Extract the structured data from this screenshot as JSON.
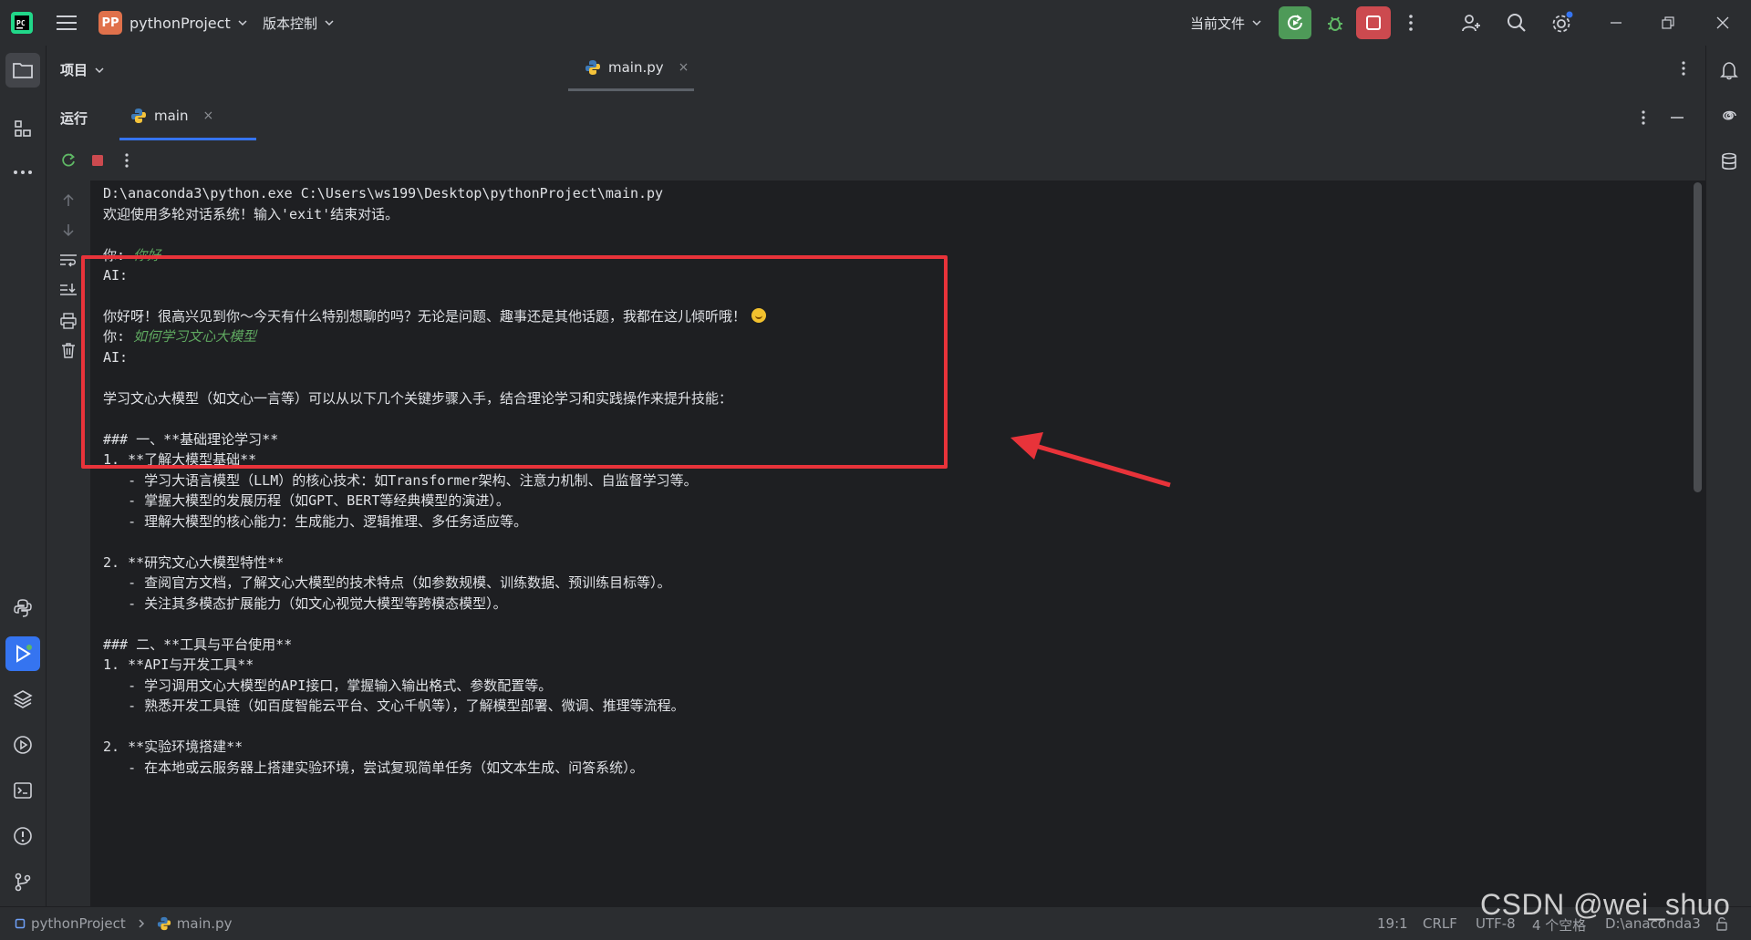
{
  "titlebar": {
    "project_badge": "PP",
    "project_name": "pythonProject",
    "vcs_label": "版本控制",
    "current_file_label": "当前文件"
  },
  "project_panel": {
    "title": "项目"
  },
  "editor": {
    "tabs": [
      {
        "label": "main.py",
        "close": "×"
      }
    ]
  },
  "run_panel": {
    "title": "运行",
    "tab_label": "main",
    "tab_close": "×"
  },
  "console": {
    "lines": [
      {
        "text": "D:\\anaconda3\\python.exe C:\\Users\\ws199\\Desktop\\pythonProject\\main.py"
      },
      {
        "text": "欢迎使用多轮对话系统！输入'exit'结束对话。"
      },
      {
        "prefix": "你: ",
        "input": "你好"
      },
      {
        "text": "AI:"
      },
      {
        "text": "你好呀！很高兴见到你～今天有什么特别想聊的吗？无论是问题、趣事还是其他话题，我都在这儿倾听哦！"
      },
      {
        "prefix": "你: ",
        "input": "如何学习文心大模型"
      },
      {
        "text": "AI:"
      },
      {
        "text": "学习文心大模型（如文心一言等）可以从以下几个关键步骤入手，结合理论学习和实践操作来提升技能："
      },
      {
        "text": "### 一、**基础理论学习**"
      },
      {
        "text": "1. **了解大模型基础**"
      },
      {
        "text": "   - 学习大语言模型（LLM）的核心技术：如Transformer架构、注意力机制、自监督学习等。"
      },
      {
        "text": "   - 掌握大模型的发展历程（如GPT、BERT等经典模型的演进）。"
      },
      {
        "text": "   - 理解大模型的核心能力：生成能力、逻辑推理、多任务适应等。"
      },
      {
        "text": "2. **研究文心大模型特性**"
      },
      {
        "text": "   - 查阅官方文档，了解文心大模型的技术特点（如参数规模、训练数据、预训练目标等）。"
      },
      {
        "text": "   - 关注其多模态扩展能力（如文心视觉大模型等跨模态模型）。"
      },
      {
        "text": "### 二、**工具与平台使用**"
      },
      {
        "text": "1. **API与开发工具**"
      },
      {
        "text": "   - 学习调用文心大模型的API接口，掌握输入输出格式、参数配置等。"
      },
      {
        "text": "   - 熟悉开发工具链（如百度智能云平台、文心千帆等），了解模型部署、微调、推理等流程。"
      },
      {
        "text": "2. **实验环境搭建**"
      },
      {
        "text": "   - 在本地或云服务器上搭建实验环境，尝试复现简单任务（如文本生成、问答系统）。"
      }
    ]
  },
  "statusbar": {
    "breadcrumb_project": "pythonProject",
    "breadcrumb_file": "main.py",
    "position": "19:1",
    "line_ending": "CRLF",
    "encoding": "UTF-8",
    "indent": "4 个空格",
    "interpreter": "D:\\anaconda3"
  },
  "watermark": "CSDN @wei_shuo",
  "colors": {
    "accent": "#3574f0",
    "run_green": "#4e9a58",
    "stop_red": "#cc4a4f",
    "annotation_red": "#e8333a",
    "user_input_green": "#5fa860"
  }
}
